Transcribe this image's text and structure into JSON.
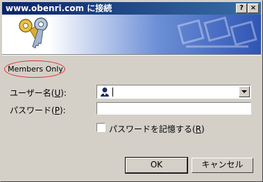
{
  "titlebar": {
    "title": "www.obenri.com に接続",
    "help_label": "?",
    "close_label": "×"
  },
  "dialog": {
    "realm": "Members Only",
    "username_label_pre": "ユーザー名(",
    "username_label_key": "U",
    "username_label_post": "):",
    "username_value": "",
    "password_label_pre": "パスワード(",
    "password_label_key": "P",
    "password_label_post": "):",
    "password_value": "",
    "remember_label_pre": "パスワードを記憶する(",
    "remember_label_key": "R",
    "remember_label_post": ")",
    "remember_checked": false,
    "ok_label": "OK",
    "cancel_label": "キャンセル"
  },
  "icons": {
    "banner": "keys-icon",
    "user": "user-icon",
    "dropdown": "chevron-down-icon"
  }
}
